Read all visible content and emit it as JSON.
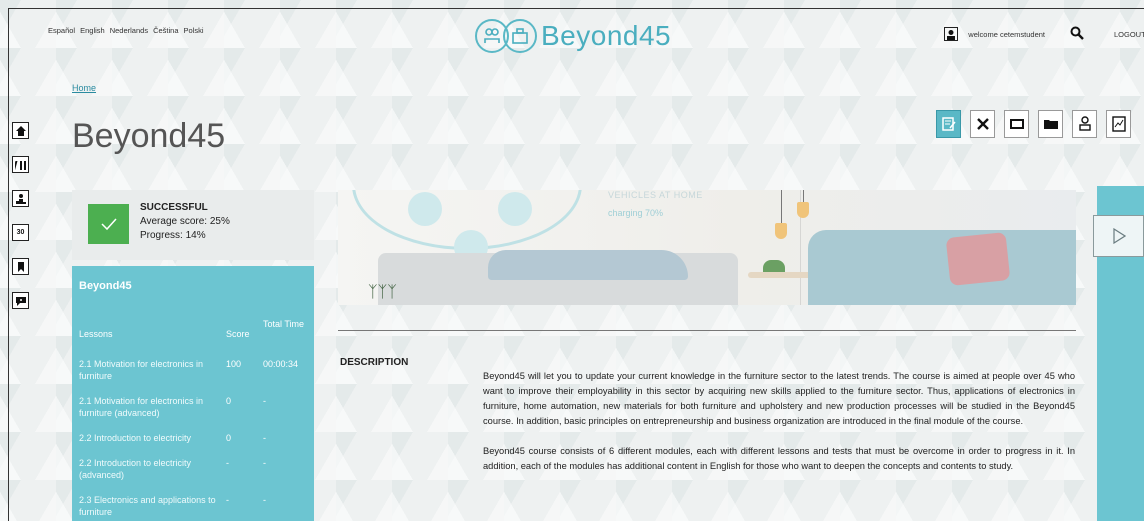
{
  "languages": [
    "Español",
    "English",
    "Nederlands",
    "Čeština",
    "Polski"
  ],
  "logo": {
    "text": "Beyond45"
  },
  "user": {
    "welcome": "welcome cetemstudent",
    "logout": "LOGOUT"
  },
  "breadcrumb": {
    "home": "Home"
  },
  "page": {
    "title": "Beyond45"
  },
  "rail": {
    "items": [
      {
        "icon": "home-icon",
        "glyph": "🏠"
      },
      {
        "icon": "library-icon",
        "glyph": "▥"
      },
      {
        "icon": "ranking-icon",
        "glyph": "♜"
      },
      {
        "icon": "calendar-icon",
        "glyph": "30"
      },
      {
        "icon": "bookmark-icon",
        "glyph": "❚"
      },
      {
        "icon": "chat-icon",
        "glyph": "✉"
      }
    ]
  },
  "tools": [
    {
      "icon": "edit-notes-icon",
      "glyph": "✎",
      "active": true
    },
    {
      "icon": "tools-icon",
      "glyph": "✖",
      "active": false
    },
    {
      "icon": "presentation-icon",
      "glyph": "▭",
      "active": false
    },
    {
      "icon": "folder-icon",
      "glyph": "▰",
      "active": false
    },
    {
      "icon": "certificate-icon",
      "glyph": "♙",
      "active": false
    },
    {
      "icon": "report-icon",
      "glyph": "▤",
      "active": false
    }
  ],
  "status": {
    "title": "SUCCESSFUL",
    "average_score": "Average score: 25%",
    "progress": "Progress: 14%"
  },
  "course": {
    "title": "Beyond45",
    "columns": {
      "lesson": "Lessons",
      "score": "Score",
      "time": "Total Time"
    },
    "rows": [
      {
        "lesson": "2.1 Motivation for electronics in furniture",
        "score": "100",
        "time": "00:00:34"
      },
      {
        "lesson": "2.1 Motivation for electronics in furniture (advanced)",
        "score": "0",
        "time": "-"
      },
      {
        "lesson": "2.2 Introduction to electricity",
        "score": "0",
        "time": "-"
      },
      {
        "lesson": "2.2 Introduction to electricity (advanced)",
        "score": "-",
        "time": "-"
      },
      {
        "lesson": "2.3 Electronics and applications to furniture",
        "score": "-",
        "time": "-"
      }
    ]
  },
  "banner": {
    "vehicles": "VEHICLES AT HOME",
    "charging": "charging 70%"
  },
  "description": {
    "label": "DESCRIPTION",
    "p1": "Beyond45  will let you to update your current knowledge in the furniture sector to the latest trends. The course is aimed at people over 45 who want to improve their employability in this sector by acquiring new skills applied to the furniture sector. Thus, applications of electronics in furniture, home automation, new materials for both furniture and upholstery and new production processes will be studied in the Beyond45 course. In addition, basic principles on entrepreneurship and business organization are introduced in the final module of the course.",
    "p2": "Beyond45 course consists of 6 different modules, each with different lessons and tests that must be overcome in order to progress in it. In addition, each of the modules has additional content in English for those who want to deepen the concepts and contents to study."
  },
  "colors": {
    "accent": "#6cc5d1",
    "logo": "#4aaebf",
    "success": "#4caf50",
    "link": "#2a8ba0"
  }
}
